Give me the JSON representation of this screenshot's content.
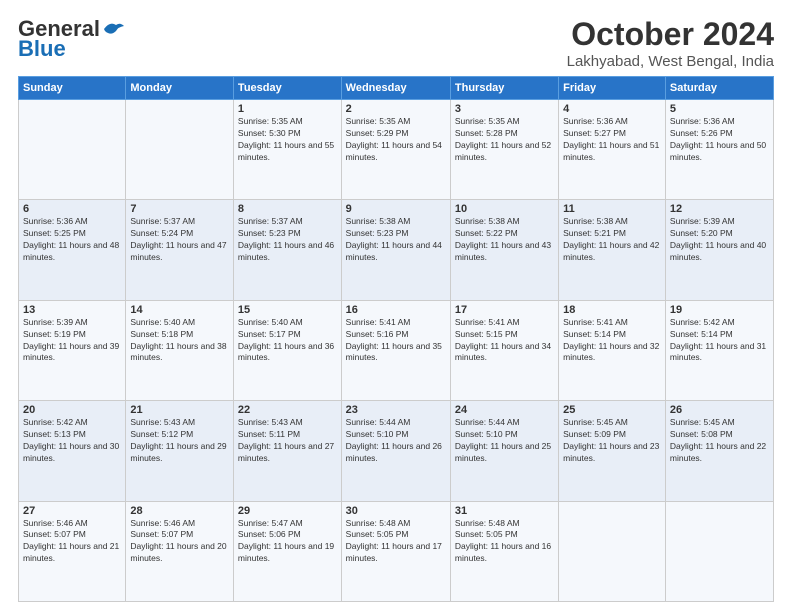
{
  "header": {
    "logo_line1": "General",
    "logo_line2": "Blue",
    "month": "October 2024",
    "location": "Lakhyabad, West Bengal, India"
  },
  "days_of_week": [
    "Sunday",
    "Monday",
    "Tuesday",
    "Wednesday",
    "Thursday",
    "Friday",
    "Saturday"
  ],
  "weeks": [
    [
      {
        "day": "",
        "info": ""
      },
      {
        "day": "",
        "info": ""
      },
      {
        "day": "1",
        "info": "Sunrise: 5:35 AM\nSunset: 5:30 PM\nDaylight: 11 hours and 55 minutes."
      },
      {
        "day": "2",
        "info": "Sunrise: 5:35 AM\nSunset: 5:29 PM\nDaylight: 11 hours and 54 minutes."
      },
      {
        "day": "3",
        "info": "Sunrise: 5:35 AM\nSunset: 5:28 PM\nDaylight: 11 hours and 52 minutes."
      },
      {
        "day": "4",
        "info": "Sunrise: 5:36 AM\nSunset: 5:27 PM\nDaylight: 11 hours and 51 minutes."
      },
      {
        "day": "5",
        "info": "Sunrise: 5:36 AM\nSunset: 5:26 PM\nDaylight: 11 hours and 50 minutes."
      }
    ],
    [
      {
        "day": "6",
        "info": "Sunrise: 5:36 AM\nSunset: 5:25 PM\nDaylight: 11 hours and 48 minutes."
      },
      {
        "day": "7",
        "info": "Sunrise: 5:37 AM\nSunset: 5:24 PM\nDaylight: 11 hours and 47 minutes."
      },
      {
        "day": "8",
        "info": "Sunrise: 5:37 AM\nSunset: 5:23 PM\nDaylight: 11 hours and 46 minutes."
      },
      {
        "day": "9",
        "info": "Sunrise: 5:38 AM\nSunset: 5:23 PM\nDaylight: 11 hours and 44 minutes."
      },
      {
        "day": "10",
        "info": "Sunrise: 5:38 AM\nSunset: 5:22 PM\nDaylight: 11 hours and 43 minutes."
      },
      {
        "day": "11",
        "info": "Sunrise: 5:38 AM\nSunset: 5:21 PM\nDaylight: 11 hours and 42 minutes."
      },
      {
        "day": "12",
        "info": "Sunrise: 5:39 AM\nSunset: 5:20 PM\nDaylight: 11 hours and 40 minutes."
      }
    ],
    [
      {
        "day": "13",
        "info": "Sunrise: 5:39 AM\nSunset: 5:19 PM\nDaylight: 11 hours and 39 minutes."
      },
      {
        "day": "14",
        "info": "Sunrise: 5:40 AM\nSunset: 5:18 PM\nDaylight: 11 hours and 38 minutes."
      },
      {
        "day": "15",
        "info": "Sunrise: 5:40 AM\nSunset: 5:17 PM\nDaylight: 11 hours and 36 minutes."
      },
      {
        "day": "16",
        "info": "Sunrise: 5:41 AM\nSunset: 5:16 PM\nDaylight: 11 hours and 35 minutes."
      },
      {
        "day": "17",
        "info": "Sunrise: 5:41 AM\nSunset: 5:15 PM\nDaylight: 11 hours and 34 minutes."
      },
      {
        "day": "18",
        "info": "Sunrise: 5:41 AM\nSunset: 5:14 PM\nDaylight: 11 hours and 32 minutes."
      },
      {
        "day": "19",
        "info": "Sunrise: 5:42 AM\nSunset: 5:14 PM\nDaylight: 11 hours and 31 minutes."
      }
    ],
    [
      {
        "day": "20",
        "info": "Sunrise: 5:42 AM\nSunset: 5:13 PM\nDaylight: 11 hours and 30 minutes."
      },
      {
        "day": "21",
        "info": "Sunrise: 5:43 AM\nSunset: 5:12 PM\nDaylight: 11 hours and 29 minutes."
      },
      {
        "day": "22",
        "info": "Sunrise: 5:43 AM\nSunset: 5:11 PM\nDaylight: 11 hours and 27 minutes."
      },
      {
        "day": "23",
        "info": "Sunrise: 5:44 AM\nSunset: 5:10 PM\nDaylight: 11 hours and 26 minutes."
      },
      {
        "day": "24",
        "info": "Sunrise: 5:44 AM\nSunset: 5:10 PM\nDaylight: 11 hours and 25 minutes."
      },
      {
        "day": "25",
        "info": "Sunrise: 5:45 AM\nSunset: 5:09 PM\nDaylight: 11 hours and 23 minutes."
      },
      {
        "day": "26",
        "info": "Sunrise: 5:45 AM\nSunset: 5:08 PM\nDaylight: 11 hours and 22 minutes."
      }
    ],
    [
      {
        "day": "27",
        "info": "Sunrise: 5:46 AM\nSunset: 5:07 PM\nDaylight: 11 hours and 21 minutes."
      },
      {
        "day": "28",
        "info": "Sunrise: 5:46 AM\nSunset: 5:07 PM\nDaylight: 11 hours and 20 minutes."
      },
      {
        "day": "29",
        "info": "Sunrise: 5:47 AM\nSunset: 5:06 PM\nDaylight: 11 hours and 19 minutes."
      },
      {
        "day": "30",
        "info": "Sunrise: 5:48 AM\nSunset: 5:05 PM\nDaylight: 11 hours and 17 minutes."
      },
      {
        "day": "31",
        "info": "Sunrise: 5:48 AM\nSunset: 5:05 PM\nDaylight: 11 hours and 16 minutes."
      },
      {
        "day": "",
        "info": ""
      },
      {
        "day": "",
        "info": ""
      }
    ]
  ]
}
